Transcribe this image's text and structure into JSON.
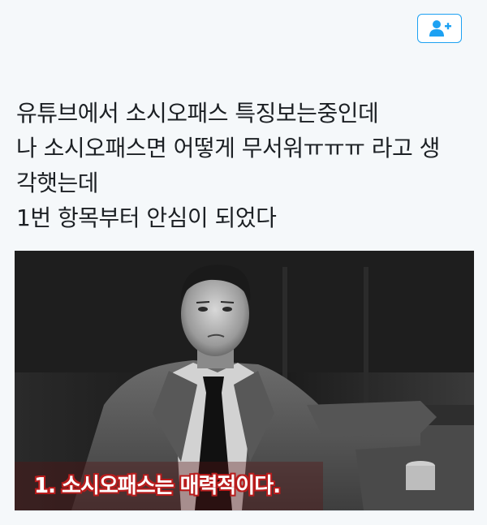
{
  "header": {
    "follow_icon": "add-user-icon",
    "accent_color": "#1da1f2"
  },
  "tweet": {
    "lines": [
      "유튜브에서 소시오패스 특징보는중인데",
      "나 소시오패스면 어떻게 무서워ㅠㅠㅠ 라고 생",
      "각햇는데",
      "1번 항목부터 안심이 되었다"
    ]
  },
  "media": {
    "caption": "1. 소시오패스는 매력적이다.",
    "caption_outline_color": "#b81c1c"
  }
}
